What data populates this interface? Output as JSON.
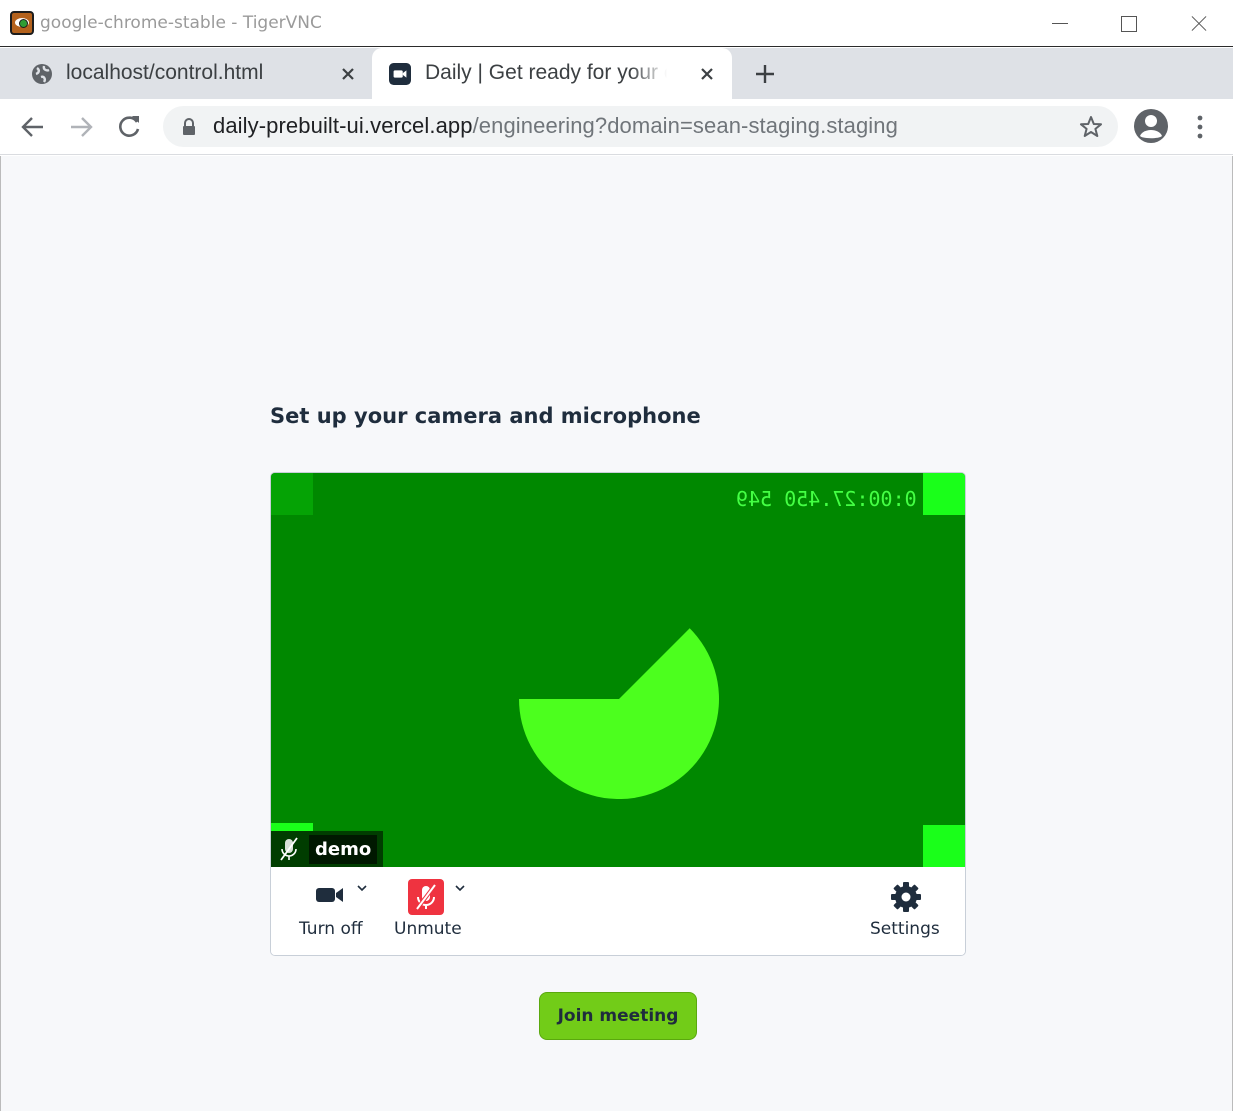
{
  "window": {
    "title": "google-chrome-stable - TigerVNC"
  },
  "tabs": [
    {
      "label": "localhost/control.html",
      "favicon": "globe-icon",
      "active": false
    },
    {
      "label": "Daily | Get ready for your call",
      "favicon": "daily-video-icon",
      "active": true
    }
  ],
  "address_bar": {
    "host": "daily-prebuilt-ui.vercel.app",
    "path": "/engineering?domain=sean-staging.staging"
  },
  "prejoin": {
    "heading": "Set up your camera and microphone",
    "video": {
      "timecode": "0:00:27.450 549",
      "participant_name": "demo",
      "background_color": "#008800",
      "pie_color": "#4cff1e"
    },
    "controls": {
      "camera_label": "Turn off",
      "mic_label": "Unmute",
      "settings_label": "Settings",
      "mic_muted_color": "#ef3340"
    },
    "join_label": "Join meeting",
    "join_color": "#72cc18"
  }
}
